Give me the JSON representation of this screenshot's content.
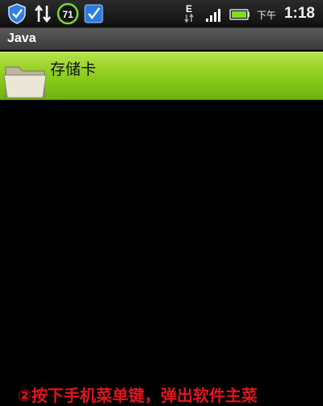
{
  "status_bar": {
    "battery_percent": "71",
    "network_type": "E",
    "ampm": "下午",
    "time": "1:18",
    "icons": [
      "shield-icon",
      "sync-arrows-icon",
      "battery-level-icon",
      "checkmark-app-icon",
      "edge-network-icon",
      "signal-strength-icon",
      "battery-icon"
    ]
  },
  "title_bar": {
    "title": "Java"
  },
  "list": {
    "items": [
      {
        "label": "存储卡",
        "icon": "folder-icon"
      }
    ]
  },
  "caption": "②按下手机菜单键，弹出软件主菜",
  "colors": {
    "list_item_bg": "#8fcf1e",
    "background": "#000000",
    "caption": "#e0141e",
    "shield": "#2f7fe0"
  }
}
